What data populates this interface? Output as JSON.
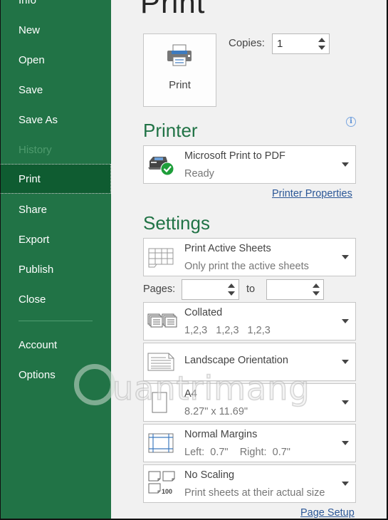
{
  "sidebar": {
    "items": [
      {
        "label": "Info",
        "state": "normal"
      },
      {
        "label": "New",
        "state": "normal"
      },
      {
        "label": "Open",
        "state": "normal"
      },
      {
        "label": "Save",
        "state": "normal"
      },
      {
        "label": "Save As",
        "state": "normal"
      },
      {
        "label": "History",
        "state": "disabled"
      },
      {
        "label": "Print",
        "state": "active"
      },
      {
        "label": "Share",
        "state": "normal"
      },
      {
        "label": "Export",
        "state": "normal"
      },
      {
        "label": "Publish",
        "state": "normal"
      },
      {
        "label": "Close",
        "state": "normal"
      },
      {
        "label": "Account",
        "state": "normal"
      },
      {
        "label": "Options",
        "state": "normal"
      }
    ]
  },
  "main": {
    "title": "Print",
    "print_button": {
      "label": "Print",
      "icon": "printer-icon"
    },
    "copies": {
      "label": "Copies:",
      "value": "1"
    },
    "printer": {
      "section_title": "Printer",
      "info_icon": "i",
      "name": "Microsoft Print to PDF",
      "status": "Ready",
      "properties_link": "Printer Properties"
    },
    "settings": {
      "section_title": "Settings",
      "what_to_print": {
        "title": "Print Active Sheets",
        "subtitle": "Only print the active sheets"
      },
      "pages": {
        "label": "Pages:",
        "to_label": "to",
        "from_value": "",
        "to_value": ""
      },
      "collation": {
        "title": "Collated",
        "subtitle": "1,2,3    1,2,3    1,2,3"
      },
      "orientation": {
        "title": "Landscape Orientation"
      },
      "paper": {
        "title": "A4",
        "subtitle": "8.27\" x 11.69\""
      },
      "margins": {
        "title": "Normal Margins",
        "subtitle": "Left:  0.7\"    Right:  0.7\""
      },
      "scaling": {
        "title": "No Scaling",
        "subtitle": "Print sheets at their actual size",
        "icon_badge": "100"
      },
      "page_setup_link": "Page Setup"
    }
  },
  "colors": {
    "sidebar_bg": "#217346",
    "sidebar_active": "#0f5c31",
    "accent_green": "#217346",
    "link_blue": "#2b5797",
    "status_ok": "#1e9e3a"
  },
  "watermark": {
    "text": "uantrimang"
  }
}
